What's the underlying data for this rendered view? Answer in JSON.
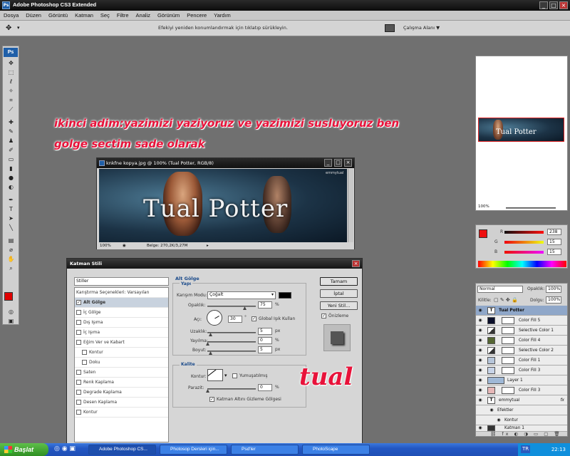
{
  "app": {
    "title": "Adobe Photoshop CS3 Extended"
  },
  "menu": [
    "Dosya",
    "Düzen",
    "Görüntü",
    "Katman",
    "Seç",
    "Filtre",
    "Analiz",
    "Görünüm",
    "Pencere",
    "Yardım"
  ],
  "options_bar": {
    "hint": "Efekiyi yeniden konumlandırmak için tıklatıp sürükleyin.",
    "workspace": "Çalışma Alanı ▼"
  },
  "annotation": {
    "line1": "ikinci adim:yazimizi yaziyoruz ve  yazimizi susluyoruz ben",
    "line2": "golge sectim sade olarak",
    "signature": "tual"
  },
  "document": {
    "title": "knkfne kopya.jpg @ 100% (Tual Potter, RGB/8)",
    "canvas_text": "Tual Potter",
    "watermark": "emmytual",
    "zoom": "100%",
    "doc_size": "Belge: 270,2K/3,27M"
  },
  "dialog": {
    "title": "Katman Stili",
    "styles_header": "Stiller",
    "styles": [
      {
        "label": "Karıştırma Seçenekleri: Varsayılan",
        "checkbox": false,
        "selected": false
      },
      {
        "label": "Alt Gölge",
        "checkbox": true,
        "checked": true,
        "selected": true
      },
      {
        "label": "İç Gölge",
        "checkbox": true,
        "checked": false
      },
      {
        "label": "Dış Işıma",
        "checkbox": true,
        "checked": false
      },
      {
        "label": "İç Işıma",
        "checkbox": true,
        "checked": false
      },
      {
        "label": "Eğim Ver ve Kabart",
        "checkbox": true,
        "checked": false
      },
      {
        "label": "Kontur",
        "checkbox": true,
        "checked": false,
        "indent": true
      },
      {
        "label": "Doku",
        "checkbox": true,
        "checked": false,
        "indent": true
      },
      {
        "label": "Saten",
        "checkbox": true,
        "checked": false
      },
      {
        "label": "Renk Kaplama",
        "checkbox": true,
        "checked": false
      },
      {
        "label": "Degrade Kaplama",
        "checkbox": true,
        "checked": false
      },
      {
        "label": "Desen Kaplama",
        "checkbox": true,
        "checked": false
      },
      {
        "label": "Kontur",
        "checkbox": true,
        "checked": false
      }
    ],
    "section_title": "Alt Gölge",
    "structure_title": "Yapı",
    "blend_mode_label": "Karışım Modu:",
    "blend_mode_value": "Çoğalt",
    "opacity_label": "Opaklık:",
    "opacity_value": "75",
    "angle_label": "Açı:",
    "angle_value": "30",
    "global_light_label": "Global Işık Kullan",
    "distance_label": "Uzaklık:",
    "distance_value": "5",
    "spread_label": "Yayılma:",
    "spread_value": "0",
    "size_label": "Boyut:",
    "size_value": "5",
    "unit_px": "px",
    "unit_pct": "%",
    "quality_title": "Kalite",
    "contour_label": "Kontur:",
    "antialias_label": "Yumuşatılmış",
    "noise_label": "Parazit:",
    "noise_value": "0",
    "knockout_label": "Katman Altını Gizleme Gölgesi",
    "ok": "Tamam",
    "cancel": "İptal",
    "new_style": "Yeni Stil...",
    "preview": "Önizleme",
    "angle_deg": "°"
  },
  "navigator": {
    "zoom": "100%"
  },
  "color_panel": {
    "r_label": "R",
    "g_label": "G",
    "b_label": "B",
    "r": "238",
    "g": "15",
    "b": "15"
  },
  "layers_panel": {
    "blend": "Normal",
    "opacity_label": "Opaklık:",
    "opacity": "100%",
    "lock_label": "Kilitle:",
    "fill_label": "Dolgu:",
    "fill": "100%",
    "layers": [
      {
        "name": "Tual Potter",
        "type": "text",
        "selected": true
      },
      {
        "name": "Color Fill 5",
        "swatch": "#0b0f2a"
      },
      {
        "name": "Selective Color 1",
        "swatch": "adjust"
      },
      {
        "name": "Color Fill 4",
        "swatch": "#556633"
      },
      {
        "name": "Selective Color 2",
        "swatch": "adjust"
      },
      {
        "name": "Color Fill 1",
        "swatch": "#b7c6da"
      },
      {
        "name": "Color Fill 3",
        "swatch": "#c8d4e8"
      },
      {
        "name": "Layer 1",
        "swatch": "#9fb8d6"
      },
      {
        "name": "Color Fill 3",
        "swatch": "#e7b8b8"
      },
      {
        "name": "emmytual",
        "type": "text"
      },
      {
        "name": "Efektler",
        "sub": true
      },
      {
        "name": "Kontur",
        "sub": true
      },
      {
        "name": "Katman 1",
        "swatch": "#333"
      }
    ]
  },
  "taskbar": {
    "start": "Başlat",
    "tasks": [
      "Adobe Photoshop CS...",
      "Photosop Dersleri için...",
      "Psd'ler",
      "PhotoScape"
    ],
    "lang": "TR",
    "time": "22:13"
  },
  "colors": {
    "accent_red": "#e8123a",
    "foreground": "#e00000",
    "background": "#ffffff"
  }
}
